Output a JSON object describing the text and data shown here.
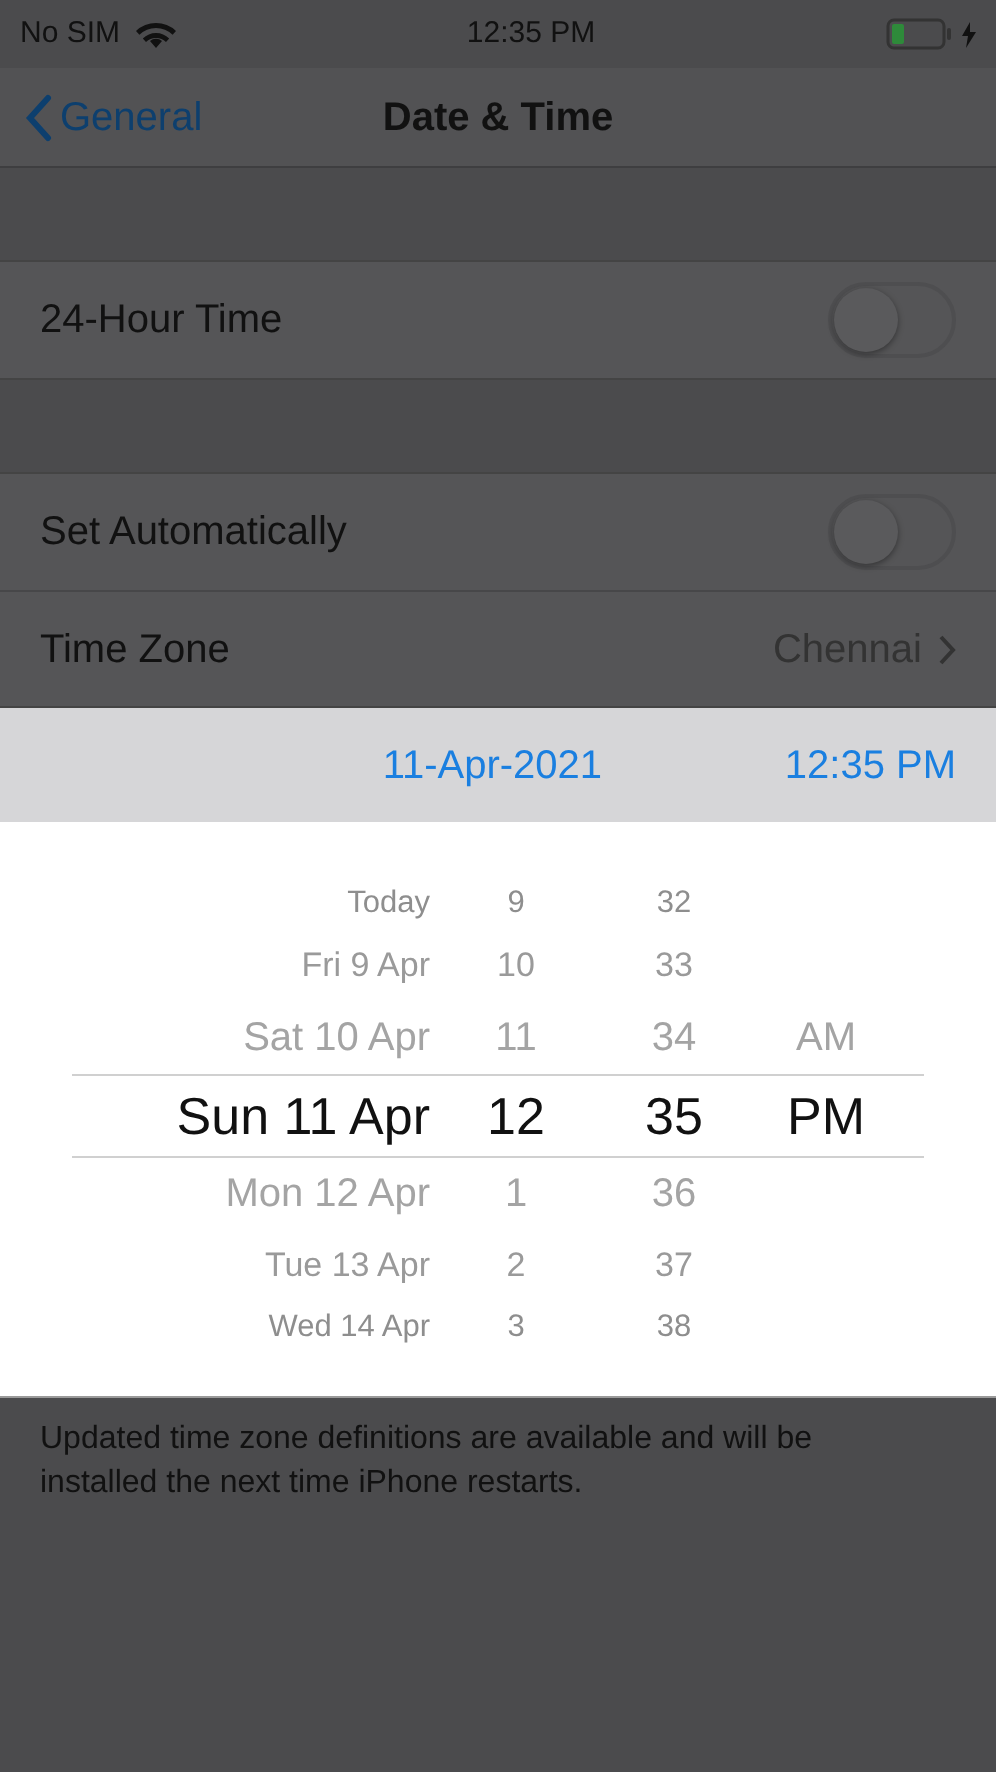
{
  "status_bar": {
    "carrier": "No SIM",
    "time": "12:35 PM"
  },
  "nav": {
    "back": "General",
    "title": "Date & Time"
  },
  "groups": [
    {
      "rows": [
        {
          "label": "24-Hour Time",
          "kind": "toggle",
          "on": false
        }
      ]
    },
    {
      "rows": [
        {
          "label": "Set Automatically",
          "kind": "toggle",
          "on": false
        },
        {
          "label": "Time Zone",
          "kind": "detail",
          "value": "Chennai"
        }
      ]
    }
  ],
  "picker_header": {
    "date": "11-Apr-2021",
    "time": "12:35 PM"
  },
  "picker_rows": [
    {
      "date": "Today",
      "hour": "9",
      "minute": "32",
      "selected": false
    },
    {
      "date": "Fri 9 Apr",
      "hour": "10",
      "minute": "33",
      "selected": false
    },
    {
      "date": "Sat 10 Apr",
      "hour": "11",
      "minute": "34",
      "period": "AM",
      "selected": false
    },
    {
      "date": "Sun 11 Apr",
      "hour": "12",
      "minute": "35",
      "period": "PM",
      "selected": true
    },
    {
      "date": "Mon 12 Apr",
      "hour": "1",
      "minute": "36",
      "selected": false
    },
    {
      "date": "Tue 13 Apr",
      "hour": "2",
      "minute": "37",
      "selected": false
    },
    {
      "date": "Wed 14 Apr",
      "hour": "3",
      "minute": "38",
      "selected": false
    }
  ],
  "footer": "Updated time zone definitions are available and will be installed the next time iPhone restarts."
}
